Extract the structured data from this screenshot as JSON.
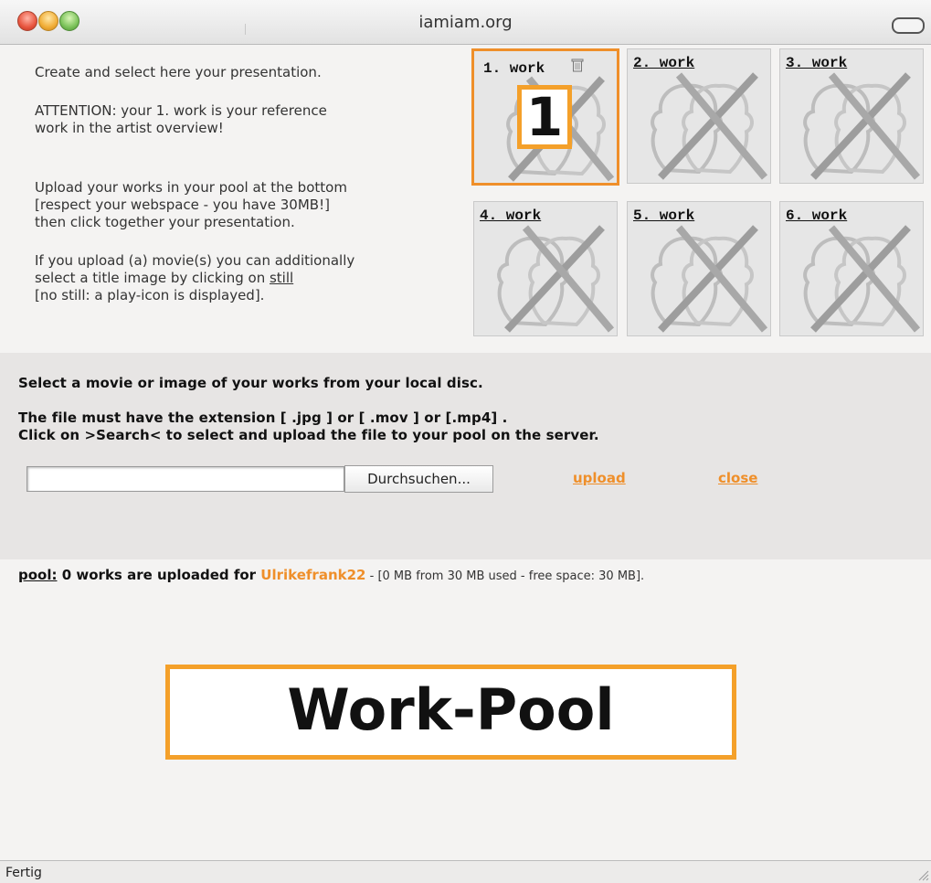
{
  "window": {
    "title": "iamiam.org"
  },
  "intro": {
    "line1": "Create and select here your presentation.",
    "line2a": "ATTENTION: your 1. work is your reference",
    "line2b": "work in the artist overview!",
    "line3a": "Upload your works in your pool at the bottom",
    "line3b": "[respect your webspace - you have 30MB!]",
    "line3c": "then click together your presentation.",
    "line4a": "If you upload (a) movie(s) you can additionally",
    "line4b": "select a title image by clicking on ",
    "still_link": "still",
    "line4c": "[no still: a play-icon is displayed]."
  },
  "works": {
    "w1": "1. work",
    "w2": "2. work",
    "w3": "3. work",
    "w4": "4. work",
    "w5": "5. work",
    "w6": "6. work",
    "badge": "1"
  },
  "upload": {
    "line1": "Select a movie or image of your works from your local disc.",
    "line2": "The file must have the extension [ .jpg ] or [ .mov ] or [.mp4] .",
    "line3": "Click on >Search< to select and upload the file to your pool on the server.",
    "browse_label": "Durchsuchen...",
    "upload_label": "upload",
    "close_label": "close"
  },
  "pool": {
    "link": "pool:",
    "count_text": " 0 works are uploaded for ",
    "user": "Ulrikefrank22",
    "dash": "  -  ",
    "usage": "[0 MB from 30 MB used - free space: 30 MB]."
  },
  "label": {
    "work_pool": "Work-Pool"
  },
  "status": {
    "text": "Fertig"
  },
  "colors": {
    "accent": "#ef8f2a",
    "badge_border": "#f4a02a",
    "panel": "#e7e5e4"
  }
}
